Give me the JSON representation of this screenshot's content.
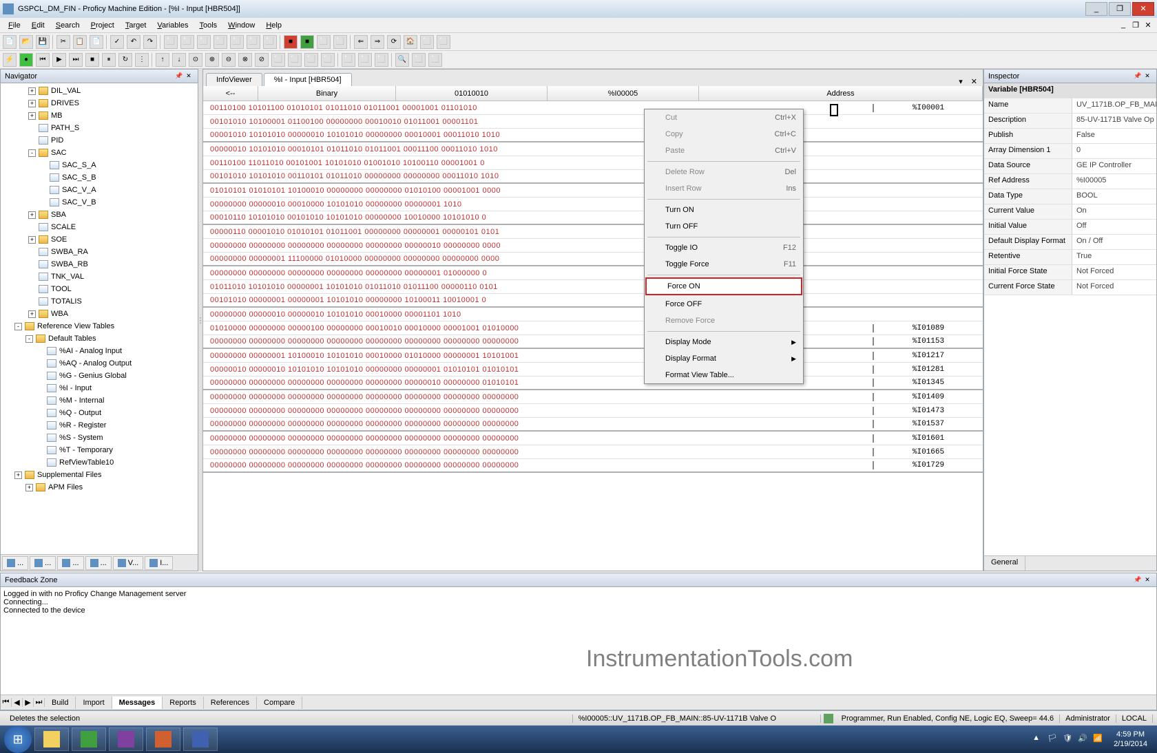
{
  "window": {
    "title": "GSPCL_DM_FIN - Proficy Machine Edition - [%I - Input [HBR504]]",
    "min": "_",
    "max": "❐",
    "close": "✕"
  },
  "menus": [
    "File",
    "Edit",
    "Search",
    "Project",
    "Target",
    "Variables",
    "Tools",
    "Window",
    "Help"
  ],
  "doc_btns": [
    "_",
    "❐",
    "✕"
  ],
  "navigator": {
    "title": "Navigator",
    "tree": [
      {
        "exp": "+",
        "cls": "folder",
        "label": "DIL_VAL",
        "ind": ""
      },
      {
        "exp": "+",
        "cls": "folder",
        "label": "DRIVES",
        "ind": ""
      },
      {
        "exp": "+",
        "cls": "folder",
        "label": "MB",
        "ind": ""
      },
      {
        "exp": "",
        "cls": "leaf",
        "label": "PATH_S",
        "ind": ""
      },
      {
        "exp": "",
        "cls": "leaf",
        "label": "PID",
        "ind": ""
      },
      {
        "exp": "-",
        "cls": "folder",
        "label": "SAC",
        "ind": ""
      },
      {
        "exp": "",
        "cls": "leaf",
        "label": "SAC_S_A",
        "ind": "ind1"
      },
      {
        "exp": "",
        "cls": "leaf",
        "label": "SAC_S_B",
        "ind": "ind1"
      },
      {
        "exp": "",
        "cls": "leaf",
        "label": "SAC_V_A",
        "ind": "ind1"
      },
      {
        "exp": "",
        "cls": "leaf",
        "label": "SAC_V_B",
        "ind": "ind1"
      },
      {
        "exp": "+",
        "cls": "folder",
        "label": "SBA",
        "ind": ""
      },
      {
        "exp": "",
        "cls": "leaf",
        "label": "SCALE",
        "ind": ""
      },
      {
        "exp": "+",
        "cls": "folder",
        "label": "SOE",
        "ind": ""
      },
      {
        "exp": "",
        "cls": "leaf",
        "label": "SWBA_RA",
        "ind": ""
      },
      {
        "exp": "",
        "cls": "leaf",
        "label": "SWBA_RB",
        "ind": ""
      },
      {
        "exp": "",
        "cls": "leaf",
        "label": "TNK_VAL",
        "ind": ""
      },
      {
        "exp": "",
        "cls": "leaf",
        "label": "TOOL",
        "ind": ""
      },
      {
        "exp": "",
        "cls": "leaf",
        "label": "TOTALIS",
        "ind": ""
      },
      {
        "exp": "+",
        "cls": "folder",
        "label": "WBA",
        "ind": ""
      }
    ],
    "rvt": {
      "label": "Reference View Tables",
      "exp": "-"
    },
    "def": {
      "label": "Default Tables",
      "exp": "-"
    },
    "tables": [
      "%AI - Analog Input",
      "%AQ - Analog Output",
      "%G - Genius Global",
      "%I - Input",
      "%M - Internal",
      "%Q - Output",
      "%R - Register",
      "%S - System",
      "%T - Temporary",
      "RefViewTable10"
    ],
    "supp": {
      "label": "Supplemental Files",
      "exp": "+"
    },
    "apm": {
      "label": "APM Files",
      "exp": "+"
    },
    "tabs": [
      "...",
      "...",
      "...",
      "...",
      "V...",
      "I..."
    ]
  },
  "main": {
    "tabs": [
      {
        "label": "InfoViewer",
        "active": false
      },
      {
        "label": "%I - Input [HBR504]",
        "active": true
      }
    ],
    "hdr": {
      "arrow": "<--",
      "c1": "Binary",
      "c2": "01010010",
      "c3": "%I00005",
      "addr": "Address"
    },
    "rows": [
      {
        "b": "00110100 10101100 01010101 01011010 01011001 00001001 01101010  ",
        "a": "%I00001",
        "alt": false
      },
      {
        "b": "00101010 10100001 01100100 00000000 00010010 01011001 00001101  ",
        "a": "",
        "alt": false
      },
      {
        "b": "00001010 10101010 00000010 10101010 00000000 00010001 00011010 1010",
        "a": "",
        "alt": true
      },
      {
        "b": "00000010 10101010 00010101 01011010 01011001 00011100 00011010 1010",
        "a": "",
        "alt": false
      },
      {
        "b": "00110100 11011010 00101001 10101010 01001010 10100110 00001001 0",
        "a": "",
        "alt": false
      },
      {
        "b": "00101010 10101010 00110101 01011010 00000000 00000000 00011010 1010",
        "a": "",
        "alt": true
      },
      {
        "b": "01010101 01010101 10100010 00000000 00000000 01010100 00001001 0000",
        "a": "",
        "alt": false
      },
      {
        "b": "00000000 00000010 00010000 10101010 00000000 00000001 1010",
        "a": "",
        "alt": false
      },
      {
        "b": "00010110 10101010 00101010 10101010 00000000 10010000 10101010 0",
        "a": "",
        "alt": true
      },
      {
        "b": "00000110 00001010 01010101 01011001 00000000 00000001 00000101 0101",
        "a": "",
        "alt": false
      },
      {
        "b": "00000000 00000000 00000000 00000000 00000000 00000010 00000000 0000",
        "a": "",
        "alt": false
      },
      {
        "b": "00000000 00000001 11100000 01010000 00000000 00000000 00000000 0000",
        "a": "",
        "alt": true
      },
      {
        "b": "00000000 00000000 00000000 00000000 00000000 00000001 01000000 0",
        "a": "",
        "alt": false
      },
      {
        "b": "01011010 10101010 00000001 10101010 01011010 01011100 00000110 0101",
        "a": "",
        "alt": false
      },
      {
        "b": "00101010 00000001 00000001 10101010 00000000 10100011 10010001 0",
        "a": "",
        "alt": true
      },
      {
        "b": "00000000 00000010 00000010 10101010 00010000 00001101 1010",
        "a": "",
        "alt": false
      },
      {
        "b": "01010000 00000000 00000100 00000000 00010010 00010000 00001001 01010000",
        "a": "%I01089",
        "alt": false
      },
      {
        "b": "00000000 00000000 00000000 00000000 00000000 00000000 00000000 00000000",
        "a": "%I01153",
        "alt": true
      },
      {
        "b": "00000000 00000001 10100010 10101010 00010000 01010000 00000001 10101001",
        "a": "%I01217",
        "alt": false
      },
      {
        "b": "00000010 00000010 10101010 10101010 00000000 00000001 01010101 01010101",
        "a": "%I01281",
        "alt": false
      },
      {
        "b": "00000000 00000000 00000000 00000000 00000000 00000010 00000000 01010101",
        "a": "%I01345",
        "alt": true
      },
      {
        "b": "00000000 00000000 00000000 00000000 00000000 00000000 00000000 00000000",
        "a": "%I01409",
        "alt": false
      },
      {
        "b": "00000000 00000000 00000000 00000000 00000000 00000000 00000000 00000000",
        "a": "%I01473",
        "alt": false
      },
      {
        "b": "00000000 00000000 00000000 00000000 00000000 00000000 00000000 00000000",
        "a": "%I01537",
        "alt": true
      },
      {
        "b": "00000000 00000000 00000000 00000000 00000000 00000000 00000000 00000000",
        "a": "%I01601",
        "alt": false
      },
      {
        "b": "00000000 00000000 00000000 00000000 00000000 00000000 00000000 00000000",
        "a": "%I01665",
        "alt": false
      },
      {
        "b": "00000000 00000000 00000000 00000000 00000000 00000000 00000000 00000000",
        "a": "%I01729",
        "alt": true
      }
    ]
  },
  "ctx": [
    {
      "t": "Cut",
      "sc": "Ctrl+X",
      "d": true
    },
    {
      "t": "Copy",
      "sc": "Ctrl+C",
      "d": true
    },
    {
      "t": "Paste",
      "sc": "Ctrl+V",
      "d": true
    },
    {
      "sep": true
    },
    {
      "t": "Delete Row",
      "sc": "Del",
      "d": true
    },
    {
      "t": "Insert Row",
      "sc": "Ins",
      "d": true
    },
    {
      "sep": true
    },
    {
      "t": "Turn ON",
      "d": false
    },
    {
      "t": "Turn OFF",
      "d": false
    },
    {
      "sep": true
    },
    {
      "t": "Toggle IO",
      "sc": "F12",
      "d": false
    },
    {
      "t": "Toggle Force",
      "sc": "F11",
      "d": false
    },
    {
      "sep": true
    },
    {
      "t": "Force ON",
      "d": false,
      "hl": true
    },
    {
      "t": "Force OFF",
      "d": false
    },
    {
      "t": "Remove Force",
      "d": true
    },
    {
      "sep": true
    },
    {
      "t": "Display Mode",
      "d": false,
      "sub": true
    },
    {
      "t": "Display Format",
      "d": false,
      "sub": true
    },
    {
      "t": "Format View Table...",
      "d": false
    }
  ],
  "inspector": {
    "title": "Inspector",
    "hdr": "Variable [HBR504]",
    "rows": [
      {
        "k": "Name",
        "v": "UV_1171B.OP_FB_MAI"
      },
      {
        "k": "Description",
        "v": "85-UV-1171B Valve Op"
      },
      {
        "k": "Publish",
        "v": "False"
      },
      {
        "k": "Array Dimension 1",
        "v": "0"
      },
      {
        "k": "Data Source",
        "v": "GE IP Controller"
      },
      {
        "k": "Ref Address",
        "v": "%I00005"
      },
      {
        "k": "Data Type",
        "v": "BOOL"
      },
      {
        "k": "Current Value",
        "v": "On"
      },
      {
        "k": "Initial Value",
        "v": "Off"
      },
      {
        "k": "Default Display Format",
        "v": "On / Off"
      },
      {
        "k": "Retentive",
        "v": "True"
      },
      {
        "k": "Initial Force State",
        "v": "Not Forced"
      },
      {
        "k": "Current Force State",
        "v": "Not Forced"
      }
    ],
    "tab": "General"
  },
  "feedback": {
    "title": "Feedback Zone",
    "lines": [
      "Logged in with no Proficy Change Management server",
      "Connecting...",
      "Connected to the device"
    ],
    "watermark": "InstrumentationTools.com",
    "tabs": [
      "Build",
      "Import",
      "Messages",
      "Reports",
      "References",
      "Compare"
    ],
    "active": "Messages"
  },
  "status": {
    "left": "Deletes the selection",
    "mid": "%I00005::UV_1171B.OP_FB_MAIN::85-UV-1171B Valve O",
    "prog": "Programmer, Run Enabled, Config NE, Logic EQ, Sweep= 44.6",
    "admin": "Administrator",
    "local": "LOCAL"
  },
  "task": {
    "time": "4:59 PM",
    "date": "2/19/2014"
  }
}
